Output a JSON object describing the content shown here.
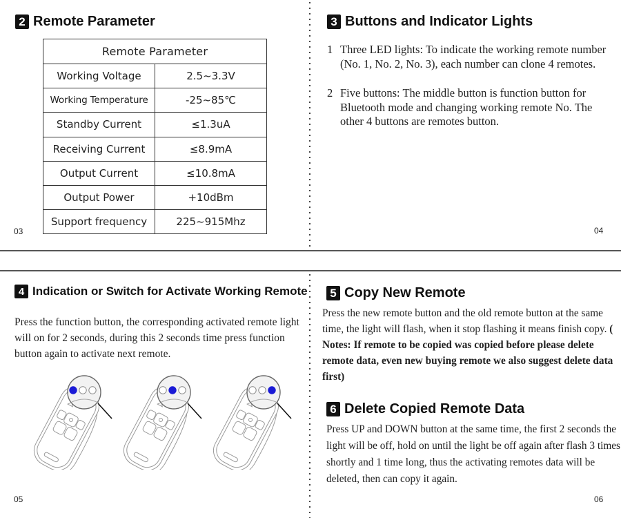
{
  "pages": [
    {
      "page_number": "03",
      "section": {
        "number": "2",
        "title": "Remote Parameter",
        "table": {
          "header": "Remote Parameter",
          "rows": [
            {
              "label": "Working Voltage",
              "value": "2.5~3.3V"
            },
            {
              "label": "Working Temperature",
              "value": "-25~85℃"
            },
            {
              "label": "Standby Current",
              "value": "≤1.3uA"
            },
            {
              "label": "Receiving Current",
              "value": "≤8.9mA"
            },
            {
              "label": "Output Current",
              "value": "≤10.8mA"
            },
            {
              "label": "Output Power",
              "value": "+10dBm"
            },
            {
              "label": "Support frequency",
              "value": "225~915Mhz"
            }
          ]
        }
      }
    },
    {
      "page_number": "04",
      "section": {
        "number": "3",
        "title": "Buttons and Indicator Lights",
        "items": [
          {
            "n": "1",
            "text": "Three LED lights: To indicate the working remote number (No. 1, No. 2, No. 3), each number can clone 4 remotes."
          },
          {
            "n": "2",
            "text": "Five buttons: The middle button is function button for Bluetooth mode and changing working remote No. The other 4 buttons are remotes button."
          }
        ]
      }
    },
    {
      "page_number": "05",
      "section": {
        "number": "4",
        "title": "Indication or Switch for Activate Working Remote",
        "text": "Press the function button, the corresponding activated remote light will on for 2 seconds, during this 2 seconds time press function button again to activate next remote.",
        "illustrations": [
          {
            "name": "remote-no-1",
            "active_led": 1
          },
          {
            "name": "remote-no-2",
            "active_led": 2
          },
          {
            "name": "remote-no-3",
            "active_led": 3
          }
        ]
      }
    },
    {
      "page_number": "06",
      "sections": [
        {
          "number": "5",
          "title": "Copy New Remote",
          "text": "Press the new remote button and the old remote button at the same time, the light will flash, when it stop flashing it means finish copy.",
          "note": "( Notes: If remote to be copied was copied before please delete remote data, even new buying remote we also suggest delete data first)"
        },
        {
          "number": "6",
          "title": "Delete Copied Remote Data",
          "text": "Press UP and DOWN button at the same time, the first 2 seconds the light will be off, hold on until the light be off again after flash 3 times shortly and 1 time long, thus the activating remotes data will be deleted, then can copy it again."
        }
      ]
    }
  ],
  "colors": {
    "led_active": "#1a1ad6",
    "led_inactive": "#ffffff",
    "badge_bg": "#111111",
    "line": "#555555"
  }
}
